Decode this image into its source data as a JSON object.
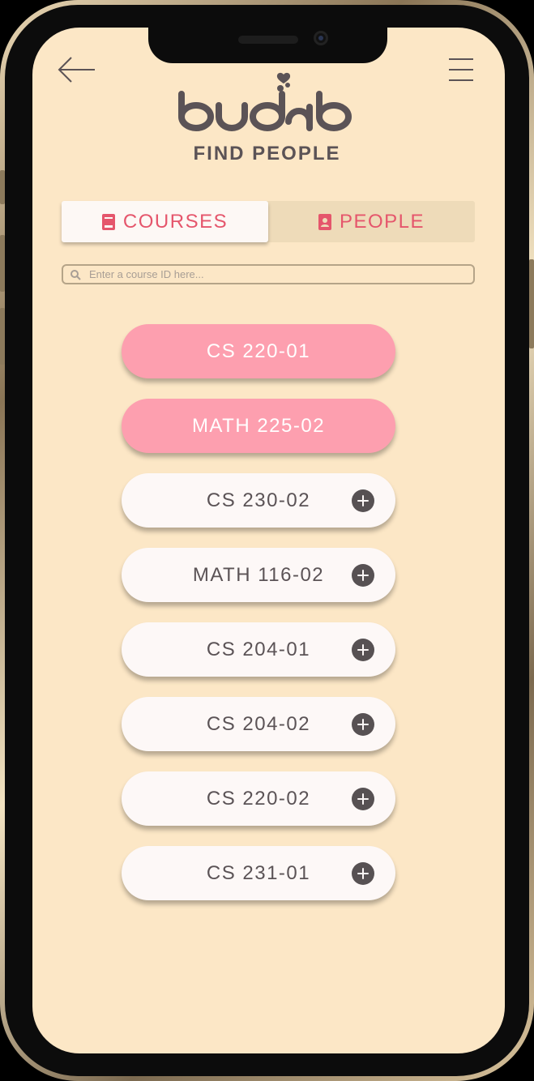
{
  "app": {
    "brand": "budab",
    "title": "FIND PEOPLE"
  },
  "tabs": [
    {
      "label": "COURSES",
      "icon": "book-icon",
      "selected": true
    },
    {
      "label": "PEOPLE",
      "icon": "contact-card-icon",
      "selected": false
    }
  ],
  "search": {
    "placeholder": "Enter a course ID here...",
    "value": ""
  },
  "courses": [
    {
      "label": "CS 220-01",
      "status": "enrolled"
    },
    {
      "label": "MATH 225-02",
      "status": "enrolled"
    },
    {
      "label": "CS 230-02",
      "status": "available"
    },
    {
      "label": "MATH 116-02",
      "status": "available"
    },
    {
      "label": "CS 204-01",
      "status": "available"
    },
    {
      "label": "CS 204-02",
      "status": "available"
    },
    {
      "label": "CS 220-02",
      "status": "available"
    },
    {
      "label": "CS 231-01",
      "status": "available"
    }
  ],
  "colors": {
    "background": "#fce7c6",
    "accent": "#e5566c",
    "enrolled_pill": "#fd9faf",
    "text_dark": "#5b5356"
  }
}
